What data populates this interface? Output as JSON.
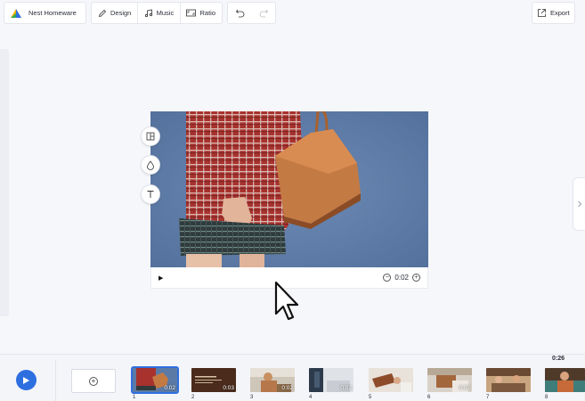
{
  "toolbar": {
    "project_name": "Nest Homeware",
    "design_label": "Design",
    "music_label": "Music",
    "ratio_label": "Ratio",
    "export_label": "Export"
  },
  "canvas": {
    "duration": "0:02"
  },
  "timeline": {
    "total_duration": "0:26",
    "clips": [
      {
        "number": "1",
        "duration": "0:02",
        "selected": true
      },
      {
        "number": "2",
        "duration": "0:03",
        "selected": false
      },
      {
        "number": "3",
        "duration": "0:02",
        "selected": false
      },
      {
        "number": "4",
        "duration": "0:02",
        "selected": false
      },
      {
        "number": "5",
        "duration": "",
        "selected": false
      },
      {
        "number": "6",
        "duration": "0:02",
        "selected": false
      },
      {
        "number": "7",
        "duration": "",
        "selected": false
      },
      {
        "number": "8",
        "duration": "",
        "selected": false
      }
    ]
  },
  "colors": {
    "accent": "#2e6fe0",
    "background": "#f6f7fb"
  },
  "icons": [
    "logo-icon",
    "pencil-icon",
    "music-icon",
    "ratio-icon",
    "undo-icon",
    "redo-icon",
    "export-icon",
    "layout-icon",
    "drop-icon",
    "text-icon",
    "play-icon",
    "zoom-out-icon",
    "zoom-in-icon",
    "add-icon",
    "chevron-right-icon",
    "cursor-icon"
  ]
}
